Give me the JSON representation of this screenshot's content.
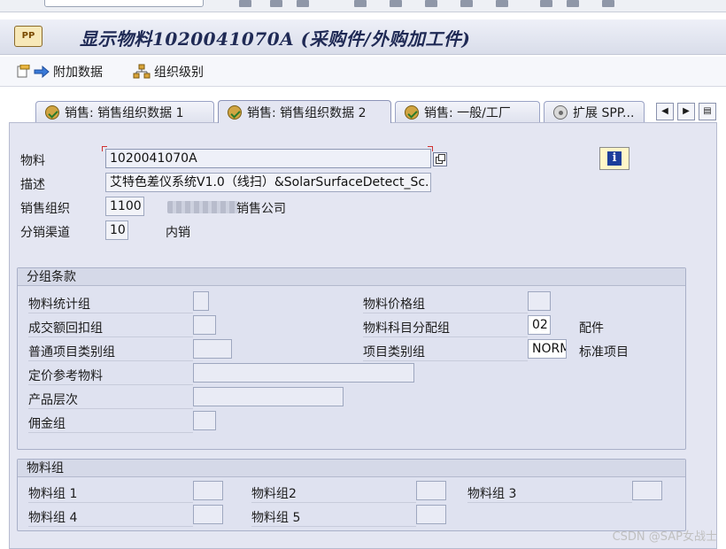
{
  "title": "显示物料1020041070A (采购件/外购加工件)",
  "toolbar": {
    "additional_data": "附加数据",
    "org_levels": "组织级别"
  },
  "tabs": [
    {
      "label": "销售: 销售组织数据 1",
      "active": false
    },
    {
      "label": "销售: 销售组织数据 2",
      "active": true
    },
    {
      "label": "销售: 一般/工厂",
      "active": false
    },
    {
      "label": "扩展 SPP...",
      "active": false
    }
  ],
  "header_fields": {
    "material_label": "物料",
    "material_value": "1020041070A",
    "desc_label": "描述",
    "desc_value": "艾特色差仪系统V1.0（线扫）&SolarSurfaceDetect_Sc...",
    "sales_org_label": "销售组织",
    "sales_org_value": "1100",
    "sales_org_text": "销售公司",
    "dist_channel_label": "分销渠道",
    "dist_channel_value": "10",
    "dist_channel_text": "内销"
  },
  "grouping": {
    "title": "分组条款",
    "mat_stat_group": "物料统计组",
    "rebate_group": "成交额回扣组",
    "gen_item_cat_group": "普通项目类别组",
    "pricing_ref_mat": "定价参考物料",
    "product_hierarchy": "产品层次",
    "commission_group": "佣金组",
    "mat_price_group": "物料价格组",
    "acct_assign_group": "物料科目分配组",
    "acct_assign_value": "02",
    "acct_assign_text": "配件",
    "item_cat_group": "项目类别组",
    "item_cat_value": "NORM",
    "item_cat_text": "标准项目"
  },
  "material_groups": {
    "title": "物料组",
    "g1": "物料组 1",
    "g2": "物料组2",
    "g3": "物料组 3",
    "g4": "物料组 4",
    "g5": "物料组 5"
  },
  "watermark": "CSDN @SAP女战士"
}
